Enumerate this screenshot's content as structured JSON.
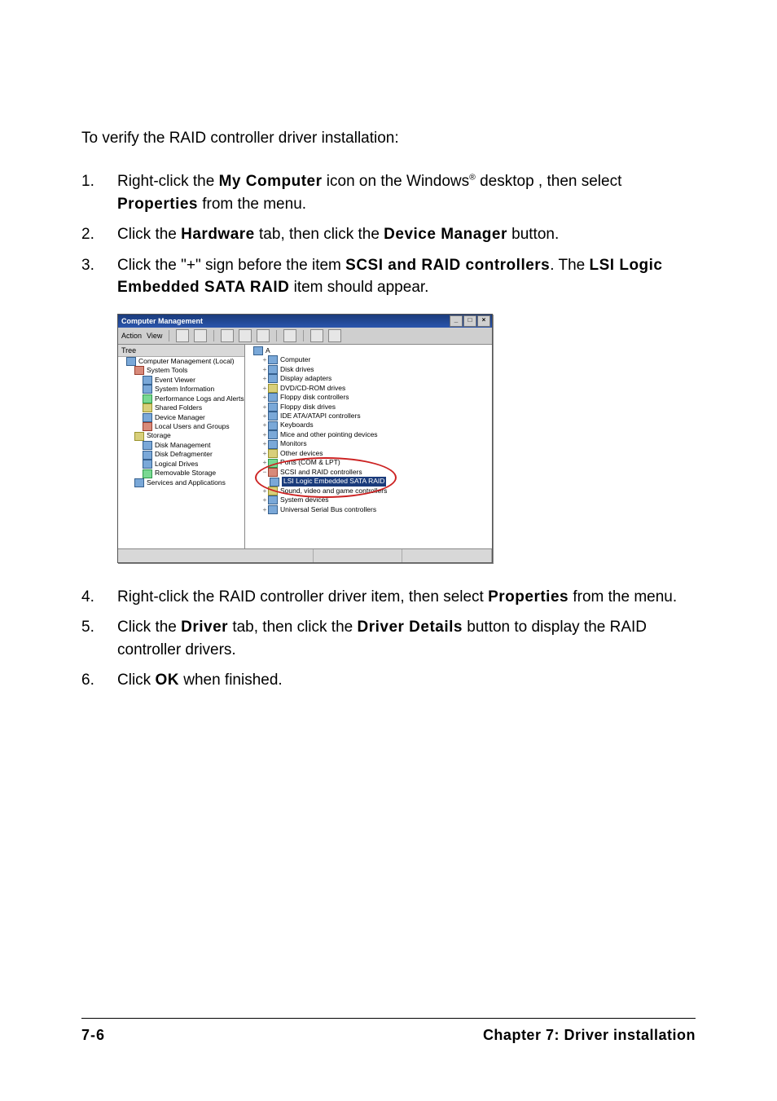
{
  "intro": "To verify the RAID controller driver installation:",
  "steps": {
    "s1": {
      "num": "1.",
      "a": "Right-click the ",
      "b": "My Computer",
      "c": " icon on the Windows",
      "reg": "®",
      "d": " desktop , then select ",
      "e": "Properties",
      "f": " from the menu."
    },
    "s2": {
      "num": "2.",
      "a": "Click the ",
      "b": "Hardware",
      "c": " tab, then click the ",
      "d": "Device Manager",
      "e": " button."
    },
    "s3": {
      "num": "3.",
      "a": "Click the \"+\" sign before the item ",
      "b": "SCSI and RAID controllers",
      "c": ". The ",
      "d": "LSI Logic Embedded SATA RAID",
      "e": " item should appear."
    },
    "s4": {
      "num": "4.",
      "a": "Right-click the RAID controller driver item, then select ",
      "b": "Properties",
      "c": " from the menu."
    },
    "s5": {
      "num": "5.",
      "a": "Click the ",
      "b": "Driver",
      "c": " tab, then click the ",
      "d": "Driver Details",
      "e": " button to display the RAID controller drivers."
    },
    "s6": {
      "num": "6.",
      "a": "Click ",
      "b": "OK",
      "c": " when finished."
    }
  },
  "shot": {
    "title": "Computer Management",
    "menu": {
      "action": "Action",
      "view": "View"
    },
    "treeTab": "Tree",
    "left": {
      "root": "Computer Management (Local)",
      "systools": "System Tools",
      "ev": "Event Viewer",
      "si": "System Information",
      "perf": "Performance Logs and Alerts",
      "sf": "Shared Folders",
      "devmgr": "Device Manager",
      "lug": "Local Users and Groups",
      "storage": "Storage",
      "dm": "Disk Management",
      "dd": "Disk Defragmenter",
      "ld": "Logical Drives",
      "rs": "Removable Storage",
      "sa": "Services and Applications"
    },
    "right": {
      "root": "A",
      "computer": "Computer",
      "disk": "Disk drives",
      "display": "Display adapters",
      "dvd": "DVD/CD-ROM drives",
      "fdc": "Floppy disk controllers",
      "fdd": "Floppy disk drives",
      "ide": "IDE ATA/ATAPI controllers",
      "kb": "Keyboards",
      "mice": "Mice and other pointing devices",
      "mon": "Monitors",
      "other": "Other devices",
      "ports": "Ports (COM & LPT)",
      "scsi": "SCSI and RAID controllers",
      "lsi": "LSI Logic Embedded SATA RAID",
      "sound": "Sound, video and game controllers",
      "sysdev": "System devices",
      "usb": "Universal Serial Bus controllers"
    },
    "winbtns": {
      "min": "_",
      "max": "□",
      "close": "×"
    }
  },
  "footer": {
    "page": "7-6",
    "chapter": "Chapter 7: Driver installation"
  }
}
